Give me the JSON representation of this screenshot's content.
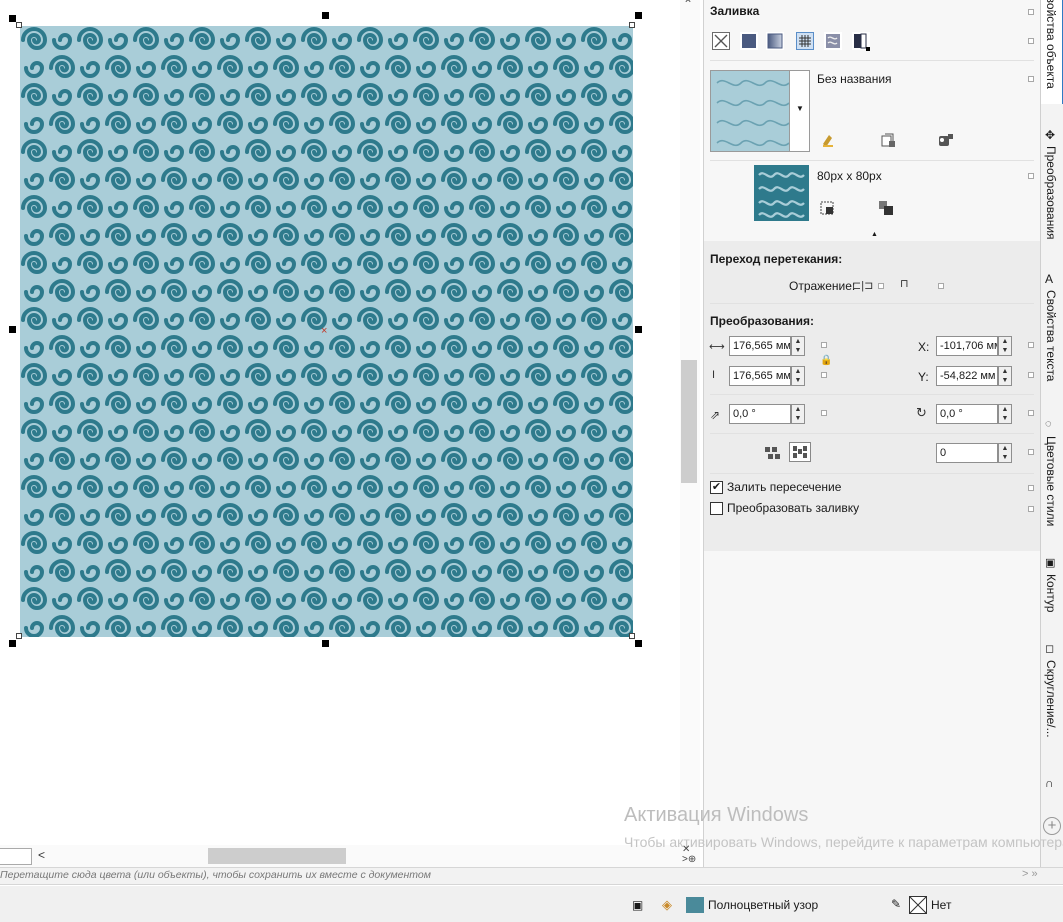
{
  "fill": {
    "title": "Заливка",
    "pattern_name": "Без названия",
    "tile_size": "80px x 80px",
    "pattern_colors": {
      "light": "#a9cdd8",
      "dark": "#2e7a8c"
    }
  },
  "transition": {
    "title": "Переход перетекания:",
    "reflection_label": "Отражение:"
  },
  "transform": {
    "title": "Преобразования:",
    "width_value": "176,565 мм",
    "height_value": "176,565 мм",
    "x_label": "X:",
    "x_value": "-101,706 мм",
    "y_label": "Y:",
    "y_value": "-54,822 мм",
    "skew_value": "0,0 °",
    "rotate_value": "0,0 °",
    "mirror_value": "0"
  },
  "options": {
    "fill_intersection": {
      "label": "Залить пересечение",
      "checked": true
    },
    "transform_fill": {
      "label": "Преобразовать заливку",
      "checked": false
    }
  },
  "tabs": [
    {
      "label": "Свойства объекта",
      "active": true
    },
    {
      "label": "Преобразования"
    },
    {
      "label": "Свойства текста"
    },
    {
      "label": "Цветовые стили"
    },
    {
      "label": "Контур"
    },
    {
      "label": "Скругление/..."
    }
  ],
  "palette_hint": "Перетащите сюда цвета (или объекты), чтобы сохранить их вместе с документом",
  "status": {
    "fill_label": "Полноцветный узор",
    "outline_label": "Нет"
  },
  "watermark": {
    "title": "Активация Windows",
    "body": "Чтобы активировать Windows, перейдите к параметрам компьютера."
  }
}
